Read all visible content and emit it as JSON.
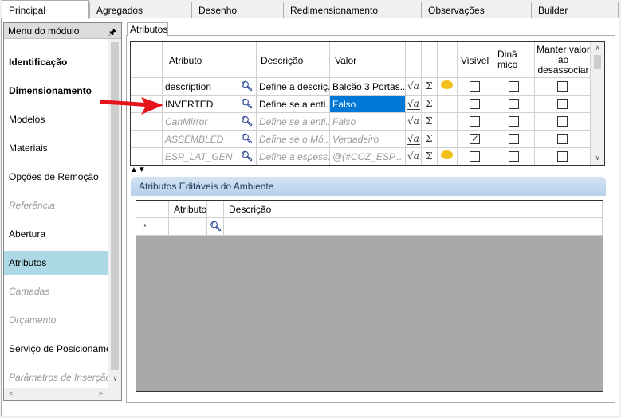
{
  "tabs": [
    {
      "label": "Principal",
      "active": true
    },
    {
      "label": "Agregados"
    },
    {
      "label": "Desenho"
    },
    {
      "label": "Redimensionamento"
    },
    {
      "label": "Observações"
    },
    {
      "label": "Builder"
    }
  ],
  "sidebar": {
    "title": "Menu do módulo",
    "items": [
      {
        "label": "Identificação",
        "state": "bold"
      },
      {
        "label": "Dimensionamento",
        "state": "bold"
      },
      {
        "label": "Modelos",
        "state": "normal"
      },
      {
        "label": "Materiais",
        "state": "normal"
      },
      {
        "label": "Opções de Remoção",
        "state": "normal"
      },
      {
        "label": "Referência",
        "state": "disabled"
      },
      {
        "label": "Abertura",
        "state": "normal"
      },
      {
        "label": "Atributos",
        "state": "selected"
      },
      {
        "label": "Camadas",
        "state": "disabled"
      },
      {
        "label": "Orçamento",
        "state": "disabled"
      },
      {
        "label": "Serviço de Posicionamen",
        "state": "normal"
      },
      {
        "label": "Parâmetros de Inserção",
        "state": "disabled"
      }
    ]
  },
  "inner_tab": "Atributos",
  "attributes_grid": {
    "headers": {
      "atributo": "Atributo",
      "descricao": "Descrição",
      "valor": "Valor",
      "visivel": "Visível",
      "dinamico": "Dinâ\nmico",
      "manter": "Manter valor ao desassociar"
    },
    "rows": [
      {
        "atributo": "description",
        "descricao": "Define a descriç...",
        "valor": "Balcão 3 Portas...",
        "dim": false,
        "selected": false,
        "bubble": true,
        "visivel": false,
        "dinamico": false,
        "manter": false
      },
      {
        "atributo": "INVERTED",
        "descricao": "Define se a enti...",
        "valor": "Falso",
        "dim": false,
        "selected": true,
        "bubble": false,
        "visivel": false,
        "dinamico": false,
        "manter": false
      },
      {
        "atributo": "CanMirror",
        "descricao": "Define se a enti...",
        "valor": "Falso",
        "dim": true,
        "selected": false,
        "bubble": false,
        "visivel": false,
        "dinamico": false,
        "manter": false
      },
      {
        "atributo": "ASSEMBLED",
        "descricao": "Define se o Mó...",
        "valor": "Verdadeiro",
        "dim": true,
        "selected": false,
        "bubble": false,
        "visivel": true,
        "dinamico": false,
        "manter": false
      },
      {
        "atributo": "ESP_LAT_GEN",
        "descricao": "Define a espess...",
        "valor": "@(#COZ_ESP...",
        "dim": true,
        "selected": false,
        "bubble": true,
        "visivel": false,
        "dinamico": false,
        "manter": false
      }
    ],
    "sigma": "Σ",
    "sqrt_glyph": "√a"
  },
  "ambiente": {
    "title": "Atributos Editáveis do Ambiente",
    "headers": {
      "atributo": "Atributo",
      "descricao": "Descrição"
    },
    "new_row_marker": "*"
  },
  "colors": {
    "selected_row": "#0078d7",
    "sidebar_selected": "#add8e6",
    "arrow": "#e8141c"
  }
}
